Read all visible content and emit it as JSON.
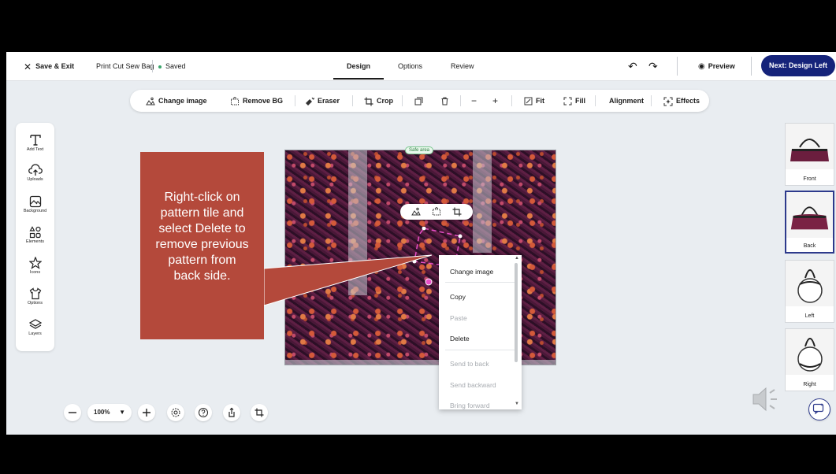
{
  "topbar": {
    "close_label": "Save & Exit",
    "project_name": "Print Cut Sew Bag",
    "saved_status": "Saved",
    "tabs": [
      {
        "label": "Design",
        "active": true
      },
      {
        "label": "Options",
        "active": false
      },
      {
        "label": "Review",
        "active": false
      }
    ],
    "preview_label": "Preview",
    "next_label": "Next: Design Left"
  },
  "toolbar": {
    "change_image": "Change image",
    "remove_bg": "Remove BG",
    "eraser": "Eraser",
    "crop": "Crop",
    "minus": "−",
    "plus": "+",
    "fit": "Fit",
    "fill": "Fill",
    "alignment": "Alignment",
    "effects": "Effects"
  },
  "left_panel": [
    {
      "label": "Add Text",
      "icon": "text-icon"
    },
    {
      "label": "Uploads",
      "icon": "upload-icon"
    },
    {
      "label": "Background",
      "icon": "background-icon"
    },
    {
      "label": "Elements",
      "icon": "elements-icon"
    },
    {
      "label": "Icons",
      "icon": "star-icon"
    },
    {
      "label": "Options",
      "icon": "shirt-icon"
    },
    {
      "label": "Layers",
      "icon": "layers-icon"
    }
  ],
  "canvas": {
    "safe_area_label": "Safe area"
  },
  "callout": {
    "line1": "Right-click on",
    "line2": "pattern tile and",
    "line3": "select Delete to",
    "line4": "remove previous",
    "line5": "pattern from",
    "line6": "back side."
  },
  "context_menu": {
    "change_image": "Change image",
    "copy": "Copy",
    "paste": "Paste",
    "delete": "Delete",
    "send_to_back": "Send to back",
    "send_backward": "Send backward",
    "bring_forward": "Bring forward"
  },
  "views": [
    {
      "label": "Front",
      "selected": false
    },
    {
      "label": "Back",
      "selected": true
    },
    {
      "label": "Left",
      "selected": false
    },
    {
      "label": "Right",
      "selected": false
    }
  ],
  "bottom": {
    "zoom_value": "100%"
  },
  "colors": {
    "accent": "#15237a",
    "callout": "#b4493b",
    "saved": "#3aa56b"
  }
}
